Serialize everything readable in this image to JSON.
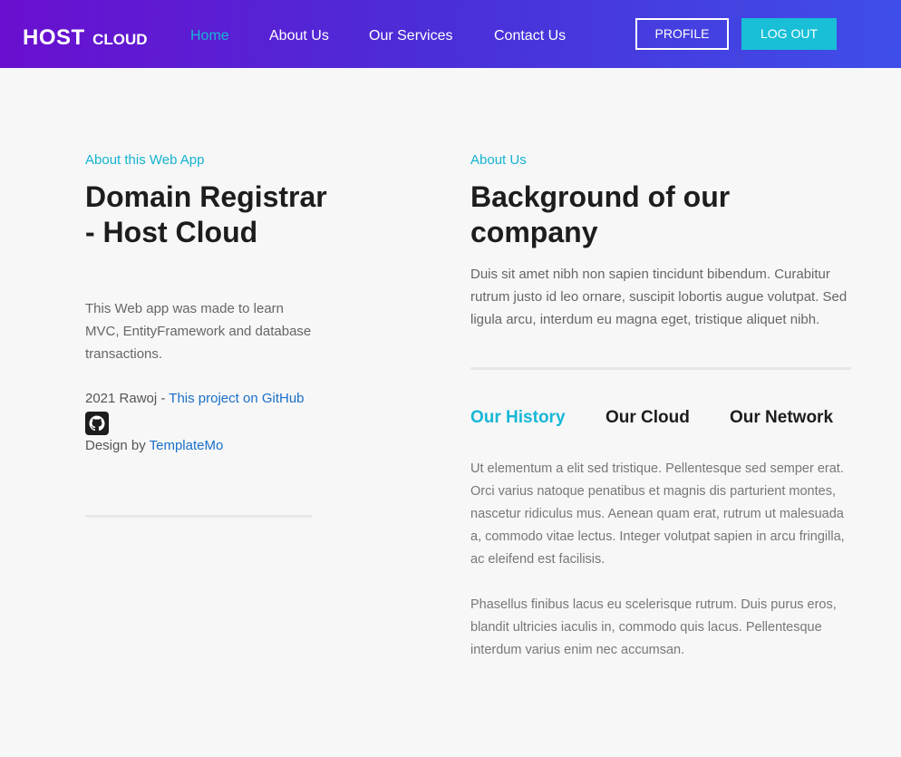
{
  "brand": {
    "main": "HOST",
    "sub": "CLOUD"
  },
  "nav": {
    "links": [
      "Home",
      "About Us",
      "Our Services",
      "Contact Us"
    ],
    "profile": "PROFILE",
    "logout": "LOG OUT"
  },
  "left": {
    "eyebrow": "About this Web App",
    "heading": "Domain Registrar - Host Cloud",
    "description": "This Web app was made to learn MVC, EntityFramework and database transactions.",
    "credit_prefix": "2021 Rawoj - ",
    "credit_link": "This project on GitHub",
    "design_prefix": "Design by ",
    "design_link": "TemplateMo"
  },
  "right": {
    "eyebrow": "About Us",
    "heading": "Background of our company",
    "intro": "Duis sit amet nibh non sapien tincidunt bibendum. Curabitur rutrum justo id leo ornare, suscipit lobortis augue volutpat. Sed ligula arcu, interdum eu magna eget, tristique aliquet nibh.",
    "tabs": [
      "Our History",
      "Our Cloud",
      "Our Network"
    ],
    "tab_para1": "Ut elementum a elit sed tristique. Pellentesque sed semper erat. Orci varius natoque penatibus et magnis dis parturient montes, nascetur ridiculus mus. Aenean quam erat, rutrum ut malesuada a, commodo vitae lectus. Integer volutpat sapien in arcu fringilla, ac eleifend est facilisis.",
    "tab_para2": "Phasellus finibus lacus eu scelerisque rutrum. Duis purus eros, blandit ultricies iaculis in, commodo quis lacus. Pellentesque interdum varius enim nec accumsan."
  },
  "colors": {
    "accent": "#18b7d6",
    "link": "#1a6fc8",
    "nav_start": "#6a0fcf",
    "nav_end": "#3f4ee8"
  },
  "icons": {
    "github": "github-icon"
  }
}
